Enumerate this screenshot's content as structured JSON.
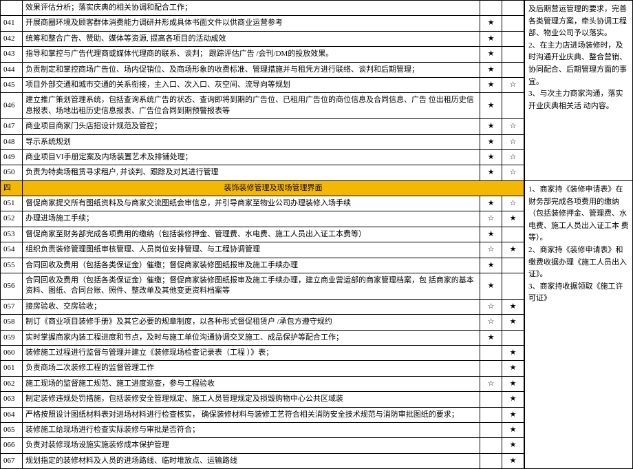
{
  "rows": [
    {
      "num": "",
      "desc": "效果评估分析；落实庆典的相关协调和配合工作；",
      "s1": "",
      "s2": ""
    },
    {
      "num": "041",
      "desc": "开展商圈环境及顾客群体消费能力调研并形成具体书面文件以供商业运营参考",
      "s1": "★",
      "s2": ""
    },
    {
      "num": "042",
      "desc": "统筹和整合广告、赞助、媒体等资源,  提高各项目的活动成效",
      "s1": "★",
      "s2": ""
    },
    {
      "num": "043",
      "desc": "指导和掌控与广告代理商或媒体代理商的联系、谈判；  跟踪评估广告       /会刊/DM的投放效果。",
      "s1": "★",
      "s2": ""
    },
    {
      "num": "044",
      "desc": "负责制定和掌控商场广告位、场内促销位、及商场形象的收费标准、管理措施并与租凭方进行联络、谈判和后期管理；",
      "s1": "★",
      "s2": ""
    },
    {
      "num": "045",
      "desc": "项目外部交通和城市交通的关系衔接，主入口、次入口、灰空间、流导向等规划",
      "s1": "★",
      "s2": "☆"
    },
    {
      "num": "046",
      "desc": "建立推广策划管理系统，包括查询系统广告的状态、查询即将到期的广告位、已租用广告位的商位信息及合同信息、广告 位出租历史信息报表、场地出租历史信息报表、广告位合同到期预警报表等",
      "s1": "★",
      "s2": ""
    },
    {
      "num": "047",
      "desc": "商业项目商家门头店招设计规范及管控；",
      "s1": "★",
      "s2": "☆"
    },
    {
      "num": "048",
      "desc": "导示系统规划",
      "s1": "★",
      "s2": "☆"
    },
    {
      "num": "049",
      "desc": "商业项目VI手册定案及内场装置艺术及排铺处理；",
      "s1": "★",
      "s2": "☆"
    },
    {
      "num": "050",
      "desc": "负责为特卖场租赁寻求租户,  并谈判、跟踪及对其进行管理",
      "s1": "★",
      "s2": "☆"
    }
  ],
  "section": {
    "num": "四",
    "title": "装饰装修管理及现场管理界面"
  },
  "rows2": [
    {
      "num": "051",
      "desc": "督促商家提交所有图纸资料及与商家交流图纸会审信息，并引导商家至物业公司办理装修入场手续",
      "s1": "★",
      "s2": "☆"
    },
    {
      "num": "052",
      "desc": "办理进场施工手续；",
      "s1": "☆",
      "s2": "★"
    },
    {
      "num": "053",
      "desc": "督促商家至财务部完成各项费用的缴纳（包括装修押金、管理费、水电费、施工人员出入证工本费等）",
      "s1": "★",
      "s2": ""
    },
    {
      "num": "054",
      "desc": "组织负责装修管理图纸审核管理、人员岗位安排管理、与工程协调管理",
      "s1": "☆",
      "s2": "★"
    },
    {
      "num": "055",
      "desc": "合同回收及费用（包括各类保证金）催缴；督促商家装修图纸报审及施工手续办理",
      "s1": "★",
      "s2": ""
    },
    {
      "num": "056",
      "desc": "合同回收及费用（包括各类保证金）催缴；督促商家装修图纸报审及施工手续办理，建立商业营运部的商家管理档案，包  括商家的基本资料、图纸、合同台账、照件、整改单及其他变更资料档案等",
      "s1": "★",
      "s2": ""
    },
    {
      "num": "057",
      "desc": "接房验收、交房验收；",
      "s1": "☆",
      "s2": "★"
    },
    {
      "num": "058",
      "desc": "制订《商业项目装修手册》及其它必要的规章制度，以各种形式督促租赁户       /承包方遵守规约",
      "s1": "☆",
      "s2": "★"
    },
    {
      "num": "059",
      "desc": "实时掌握商家内装工程进度和节点，及时与施工单位沟通协调交叉施工、成品保护等配合工作；",
      "s1": "★",
      "s2": ""
    },
    {
      "num": "060",
      "desc": "装修施工过程进行监督与管理并建立《装修现场检查记录表（工程       ）》表；",
      "s1": "",
      "s2": "★"
    },
    {
      "num": "061",
      "desc": "负责商场二次装修工程的监督管理工作",
      "s1": "",
      "s2": "★"
    },
    {
      "num": "062",
      "desc": "施工现场的监督施工规范、施工进度巡查，参与工程验收",
      "s1": "☆",
      "s2": "★"
    },
    {
      "num": "063",
      "desc": "制定装修违规处罚措施，包括装修安全管理规定、施工人员管理规定及损毁购物中心公共区域装",
      "s1": "",
      "s2": "★"
    },
    {
      "num": "064",
      "desc": "严格按照设计图纸材料表对进场材料进行检查核实，     确保装修材料与装修工艺符合相关消防安全技术规范与消防审批图纸的要求；",
      "s1": "",
      "s2": "★"
    },
    {
      "num": "065",
      "desc": "装修施工给现场进行检查实际装修与审批是否符合；",
      "s1": "",
      "s2": "★"
    },
    {
      "num": "066",
      "desc": "负责对装修现场设施实施装修成本保护管理",
      "s1": "",
      "s2": "★"
    },
    {
      "num": "067",
      "desc": "规划指定的装修材料及人员的进场路线、临时堆放点、运输路线",
      "s1": "",
      "s2": "★"
    }
  ],
  "side": {
    "top": "及后期营运管理的要求，完善各类管理方案，牵头协调工程部、物业公司予以落实。\n2、在主力店进场装修时，及时沟通开业庆典、整合营销、协同配合、后期管理方面的事宜。\n3、与次主力商家沟通，落实开业庆典相关活 动内容。",
    "bottom": "1、商家持《装修申请表》在财务部完成各项费用的缴纳（包括装修押金、管理费、水电费、施工人员出入证工本 费等）。\n2、商家持《装修申请表》和缴费收据办理《施工人员出入证》。\n3、商家持收据领取《施工许可证》"
  }
}
